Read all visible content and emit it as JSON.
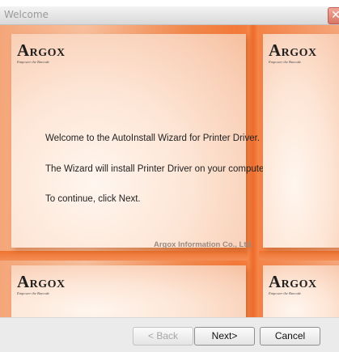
{
  "window": {
    "title": "Welcome",
    "close_glyph": "✕"
  },
  "brand": {
    "logo_first": "A",
    "logo_rest": "RGOX",
    "tagline": "Empower the Barcode"
  },
  "message": {
    "line1": "Welcome to the AutoInstall Wizard for Printer Driver.",
    "line2": "The Wizard will install Printer Driver on your computer.",
    "line3": "To continue, click Next."
  },
  "company": "Argox Information Co., Ltd.",
  "buttons": {
    "back": "< Back",
    "next": "Next>",
    "cancel": "Cancel",
    "back_enabled": false
  },
  "colors": {
    "accent_orange": "#f37a3a",
    "panel_peach": "#fde5d5",
    "bar_gray": "#ebebeb"
  }
}
